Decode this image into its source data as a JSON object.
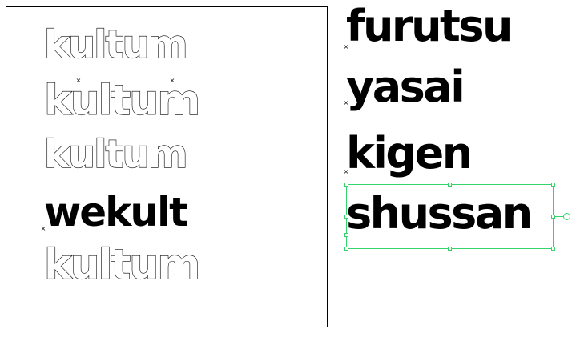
{
  "canvas": {
    "artboard_words": [
      {
        "text": "kultum",
        "style": "outline"
      },
      {
        "text": "kultum",
        "style": "outline-with-rule"
      },
      {
        "text": "kultum",
        "style": "outline"
      },
      {
        "text": "wekult",
        "style": "solid"
      },
      {
        "text": "kultum",
        "style": "outline"
      }
    ],
    "side_words": [
      {
        "text": "furutsu"
      },
      {
        "text": "yasai"
      },
      {
        "text": "kigen"
      },
      {
        "text": "shussan",
        "selected": true
      }
    ]
  },
  "colors": {
    "selection": "#35d46b",
    "text": "#000000",
    "background": "#ffffff"
  },
  "icons": {
    "anchor": "x-mark-icon",
    "rotate": "rotate-handle-icon"
  },
  "anchor_glyph": "×"
}
